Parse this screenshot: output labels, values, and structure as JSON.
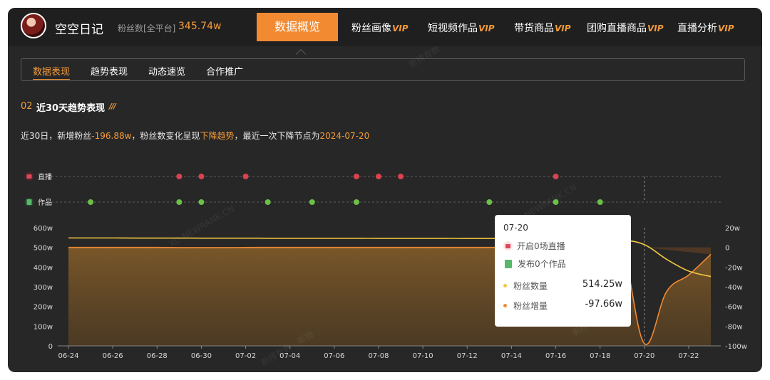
{
  "header": {
    "account_name": "空空日记",
    "fans_label": "粉丝数[全平台]",
    "fans_value": "345.74w",
    "tabs": [
      {
        "label": "数据概览",
        "vip": ""
      },
      {
        "label": "粉丝画像",
        "vip": "VIP"
      },
      {
        "label": "短视频作品",
        "vip": "VIP"
      },
      {
        "label": "带货商品",
        "vip": "VIP"
      },
      {
        "label": "团购直播商品",
        "vip": "VIP"
      },
      {
        "label": "直播分析",
        "vip": "VIP"
      }
    ]
  },
  "subtabs": [
    "数据表现",
    "趋势表现",
    "动态速览",
    "合作推广"
  ],
  "section": {
    "number": "02",
    "title": "近30天趋势表现"
  },
  "summary": {
    "prefix": "近30日，新增粉丝",
    "new_fans": "-196.88w",
    "middle": "，粉丝数变化呈现",
    "trend": "下降趋势",
    "suffix": "，最近一次下降节点为",
    "last_drop_date": "2024-07-20"
  },
  "watermarks": [
    "新榜有数",
    "新榜有数 · 新榜",
    "XD.NEWRANK.CN",
    "XD.NEWRANK.CN",
    "新榜有"
  ],
  "colors": {
    "accent": "#f39a3b",
    "live_dot": "#d9424f",
    "works_dot": "#6cbf47",
    "fans_line": "#f1c842",
    "growth_line": "#f08a34"
  },
  "chart_data": {
    "type": "line",
    "x": [
      "06-24",
      "06-25",
      "06-26",
      "06-27",
      "06-28",
      "06-29",
      "06-30",
      "07-01",
      "07-02",
      "07-03",
      "07-04",
      "07-05",
      "07-06",
      "07-07",
      "07-08",
      "07-09",
      "07-10",
      "07-11",
      "07-12",
      "07-13",
      "07-14",
      "07-15",
      "07-16",
      "07-17",
      "07-18",
      "07-19",
      "07-20",
      "07-21",
      "07-22",
      "07-23"
    ],
    "x_tick_labels": [
      "06-24",
      "06-26",
      "06-28",
      "06-30",
      "07-02",
      "07-04",
      "07-06",
      "07-08",
      "07-10",
      "07-12",
      "07-14",
      "07-16",
      "07-18",
      "07-20",
      "07-22"
    ],
    "events": {
      "live": {
        "label": "直播",
        "dates": [
          "06-29",
          "06-30",
          "07-02",
          "07-07",
          "07-08",
          "07-09",
          "07-16"
        ]
      },
      "works": {
        "label": "作品",
        "dates": [
          "06-25",
          "06-29",
          "06-30",
          "07-03",
          "07-05",
          "07-07",
          "07-13",
          "07-16",
          "07-18"
        ]
      }
    },
    "series": [
      {
        "name": "粉丝数量",
        "axis": "left",
        "values": [
          548,
          548,
          548,
          547.5,
          547.5,
          547.5,
          547,
          547,
          547,
          546.5,
          546.5,
          546.5,
          546.5,
          546.5,
          546,
          546,
          546,
          546,
          545.5,
          545.5,
          545.5,
          545,
          545,
          545,
          544.5,
          538,
          514.25,
          440,
          380,
          352
        ]
      },
      {
        "name": "粉丝增量",
        "axis": "right",
        "values": [
          0,
          0,
          0,
          0,
          0,
          -0.2,
          -0.2,
          -0.2,
          -0.1,
          0,
          0,
          0,
          0,
          0,
          0,
          0,
          0,
          0,
          0,
          0,
          -0.1,
          -0.2,
          -0.2,
          0,
          0,
          -0.3,
          -97.66,
          -45,
          -28,
          -7
        ]
      }
    ],
    "y_left": {
      "ticks": [
        "0",
        "100w",
        "200w",
        "300w",
        "400w",
        "500w",
        "600w"
      ],
      "ylim": [
        0,
        600
      ]
    },
    "y_right": {
      "ticks": [
        "-100w",
        "-80w",
        "-60w",
        "-40w",
        "-20w",
        "0",
        "20w"
      ],
      "ylim": [
        -100,
        20
      ]
    },
    "tooltip": {
      "date": "07-20",
      "live_text": "开启0场直播",
      "works_text": "发布0个作品",
      "rows": [
        {
          "name": "粉丝数量",
          "value": "514.25w"
        },
        {
          "name": "粉丝增量",
          "value": "-97.66w"
        }
      ]
    }
  }
}
